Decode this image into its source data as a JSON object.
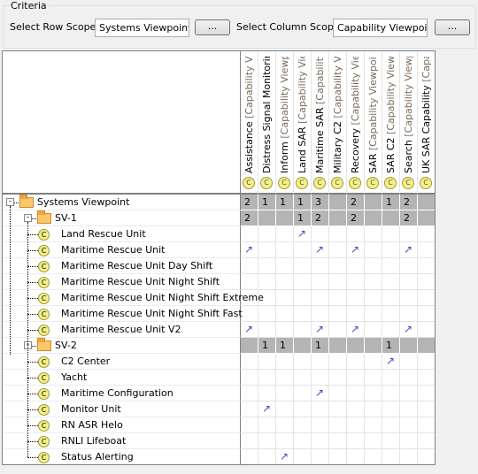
{
  "criteria": {
    "title": "Criteria",
    "row_scope_label": "Select Row Scope:",
    "row_scope_value": "Systems Viewpoint",
    "column_scope_label": "Select Column Scope:",
    "column_scope_value": "Capability Viewpoint",
    "browse_label": "..."
  },
  "columns": [
    {
      "name": "Assistance",
      "suffix": " [Capability Vie..."
    },
    {
      "name": "Distress Signal Monitoring",
      "suffix": " ..."
    },
    {
      "name": "Inform",
      "suffix": " [Capability Viewpoi..."
    },
    {
      "name": "Land SAR",
      "suffix": " [Capability View..."
    },
    {
      "name": "Maritime SAR",
      "suffix": " [Capability Vi..."
    },
    {
      "name": "Military C2",
      "suffix": " [Capability Vie..."
    },
    {
      "name": "Recovery",
      "suffix": " [Capability View..."
    },
    {
      "name": "SAR",
      "suffix": " [Capability Viewpoint:..."
    },
    {
      "name": "SAR C2",
      "suffix": " [Capability Viewpo..."
    },
    {
      "name": "Search",
      "suffix": " [Capability Viewpoi..."
    },
    {
      "name": "UK SAR Capability",
      "suffix": " [Capabil..."
    }
  ],
  "rows": [
    {
      "label": "Systems Viewpoint",
      "kind": "package",
      "level": 0,
      "summary": true,
      "cells": [
        "2",
        "1",
        "1",
        "1",
        "3",
        "",
        "2",
        "",
        "1",
        "2",
        ""
      ]
    },
    {
      "label": "SV-1",
      "kind": "package",
      "level": 1,
      "summary": true,
      "cells": [
        "2",
        "",
        "",
        "1",
        "2",
        "",
        "2",
        "",
        "",
        "2",
        ""
      ]
    },
    {
      "label": "Land Rescue Unit",
      "kind": "class",
      "level": 2,
      "cells": [
        "",
        "",
        "",
        "↗",
        "",
        "",
        "",
        "",
        "",
        "",
        ""
      ]
    },
    {
      "label": "Maritime Rescue Unit",
      "kind": "class",
      "level": 2,
      "cells": [
        "↗",
        "",
        "",
        "",
        "↗",
        "",
        "↗",
        "",
        "",
        "↗",
        ""
      ]
    },
    {
      "label": "Maritime Rescue Unit Day Shift",
      "kind": "class",
      "level": 2,
      "cells": [
        "",
        "",
        "",
        "",
        "",
        "",
        "",
        "",
        "",
        "",
        ""
      ]
    },
    {
      "label": "Maritime Rescue Unit Night Shift",
      "kind": "class",
      "level": 2,
      "cells": [
        "",
        "",
        "",
        "",
        "",
        "",
        "",
        "",
        "",
        "",
        ""
      ]
    },
    {
      "label": "Maritime Rescue Unit Night Shift Extreme",
      "kind": "class",
      "level": 2,
      "cells": [
        "",
        "",
        "",
        "",
        "",
        "",
        "",
        "",
        "",
        "",
        ""
      ]
    },
    {
      "label": "Maritime Rescue Unit Night Shift Fast",
      "kind": "class",
      "level": 2,
      "cells": [
        "",
        "",
        "",
        "",
        "",
        "",
        "",
        "",
        "",
        "",
        ""
      ]
    },
    {
      "label": "Maritime Rescue Unit V2",
      "kind": "class",
      "level": 2,
      "cells": [
        "↗",
        "",
        "",
        "",
        "↗",
        "",
        "↗",
        "",
        "",
        "↗",
        ""
      ]
    },
    {
      "label": "SV-2",
      "kind": "package",
      "level": 1,
      "summary": true,
      "cells": [
        "",
        "1",
        "1",
        "",
        "1",
        "",
        "",
        "",
        "1",
        "",
        ""
      ]
    },
    {
      "label": "C2 Center",
      "kind": "class",
      "level": 2,
      "cells": [
        "",
        "",
        "",
        "",
        "",
        "",
        "",
        "",
        "↗",
        "",
        ""
      ]
    },
    {
      "label": "Yacht",
      "kind": "class",
      "level": 2,
      "cells": [
        "",
        "",
        "",
        "",
        "",
        "",
        "",
        "",
        "",
        "",
        ""
      ]
    },
    {
      "label": "Maritime Configuration",
      "kind": "class",
      "level": 2,
      "cells": [
        "",
        "",
        "",
        "",
        "↗",
        "",
        "",
        "",
        "",
        "",
        ""
      ]
    },
    {
      "label": "Monitor Unit",
      "kind": "class",
      "level": 2,
      "cells": [
        "",
        "↗",
        "",
        "",
        "",
        "",
        "",
        "",
        "",
        "",
        ""
      ]
    },
    {
      "label": "RN ASR Helo",
      "kind": "class",
      "level": 2,
      "cells": [
        "",
        "",
        "",
        "",
        "",
        "",
        "",
        "",
        "",
        "",
        ""
      ]
    },
    {
      "label": "RNLI Lifeboat",
      "kind": "class",
      "level": 2,
      "cells": [
        "",
        "",
        "",
        "",
        "",
        "",
        "",
        "",
        "",
        "",
        ""
      ]
    },
    {
      "label": "Status Alerting",
      "kind": "class",
      "level": 2,
      "cells": [
        "",
        "",
        "↗",
        "",
        "",
        "",
        "",
        "",
        "",
        "",
        ""
      ]
    }
  ],
  "colors": {
    "summary_cell": "#b4b4b4",
    "arrow": "#3b4fc8",
    "folder": "#fbc76b",
    "class_icon": "#f4f08a"
  }
}
